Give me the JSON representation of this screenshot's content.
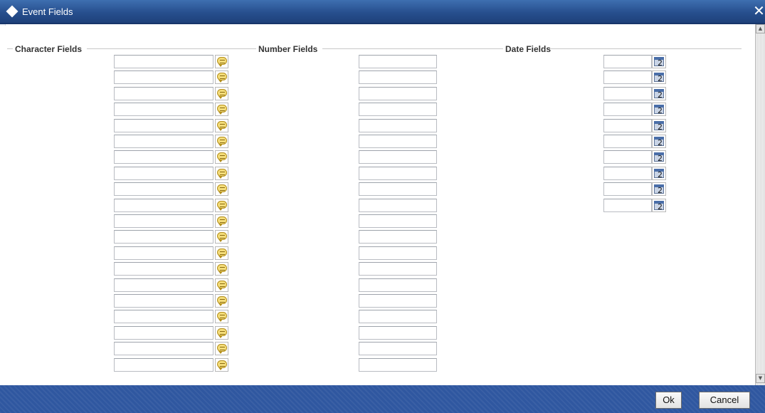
{
  "window": {
    "title": "Event Fields",
    "close_icon": "close-icon"
  },
  "sections": {
    "character": {
      "label": "Character Fields",
      "field_count": 20,
      "button_icon": "lov-speech-bubble-icon"
    },
    "number": {
      "label": "Number Fields",
      "field_count": 20
    },
    "date": {
      "label": "Date Fields",
      "field_count": 10,
      "button_icon": "calendar-icon",
      "button_glyph": "2"
    }
  },
  "footer": {
    "ok_label": "Ok",
    "cancel_label": "Cancel"
  },
  "colors": {
    "titlebar": "#2a5494",
    "footer": "#2f57a0",
    "section_label": "#333333"
  }
}
